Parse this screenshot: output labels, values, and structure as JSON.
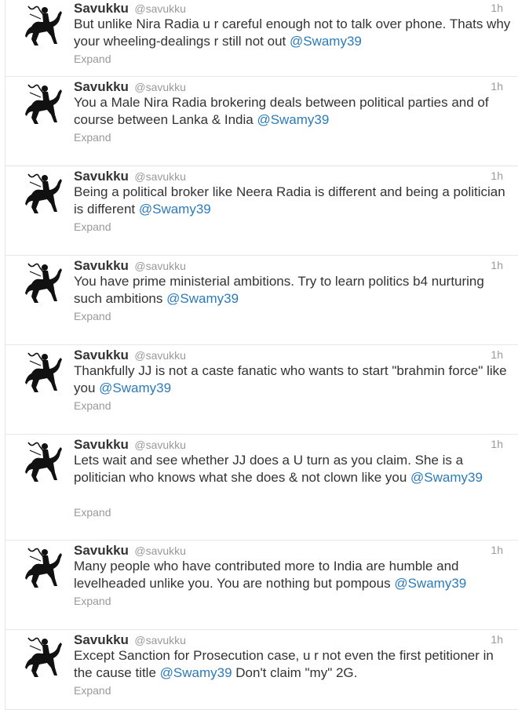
{
  "tweets": [
    {
      "fullname": "Savukku",
      "username": "@savukku",
      "time": "1h",
      "text": "But unlike Nira Radia u r careful enough not to talk over phone. Thats why your wheeling-dealings r still not out ",
      "mention": "@Swamy39",
      "after": "",
      "expand": "Expand",
      "lines": 2
    },
    {
      "fullname": "Savukku",
      "username": "@savukku",
      "time": "1h",
      "text": "You a Male Nira Radia brokering deals between political parties and of course between Lanka & India ",
      "mention": "@Swamy39",
      "after": "",
      "expand": "Expand",
      "lines": 2
    },
    {
      "fullname": "Savukku",
      "username": "@savukku",
      "time": "1h",
      "text": "Being a political broker like Neera Radia is different and being a politician is different ",
      "mention": "@Swamy39",
      "after": "",
      "expand": "Expand",
      "lines": 2
    },
    {
      "fullname": "Savukku",
      "username": "@savukku",
      "time": "1h",
      "text": "You have prime ministerial ambitions. Try to learn politics b4 nurturing such ambitions ",
      "mention": "@Swamy39",
      "after": "",
      "expand": "Expand",
      "lines": 2
    },
    {
      "fullname": "Savukku",
      "username": "@savukku",
      "time": "1h",
      "text": "Thankfully JJ is not a caste fanatic who wants to start \"brahmin force\" like you ",
      "mention": "@Swamy39",
      "after": "",
      "expand": "Expand",
      "lines": 2
    },
    {
      "fullname": "Savukku",
      "username": "@savukku",
      "time": "1h",
      "text": "Lets wait and see whether JJ does a U turn as you claim. She is a politician who knows what she does & not clown like you ",
      "mention": "@Swamy39",
      "after": "",
      "expand": "Expand",
      "lines": 3
    },
    {
      "fullname": "Savukku",
      "username": "@savukku",
      "time": "1h",
      "text": "Many people who have contributed more to India are humble and levelheaded unlike you. You are nothing but pompous ",
      "mention": "@Swamy39",
      "after": "",
      "expand": "Expand",
      "lines": 2
    },
    {
      "fullname": "Savukku",
      "username": "@savukku",
      "time": "1h",
      "text": "Except Sanction for Prosecution case, u r not even the first petitioner in the cause title ",
      "mention": "@Swamy39",
      "after": " Don't claim \"my\" 2G.",
      "expand": "Expand",
      "lines": 2
    }
  ],
  "colors": {
    "link": "#2b7bb9",
    "muted": "#999999",
    "text": "#333333",
    "border": "#e6e6e6"
  },
  "icons": {
    "avatar": "horse-rider-silhouette"
  }
}
